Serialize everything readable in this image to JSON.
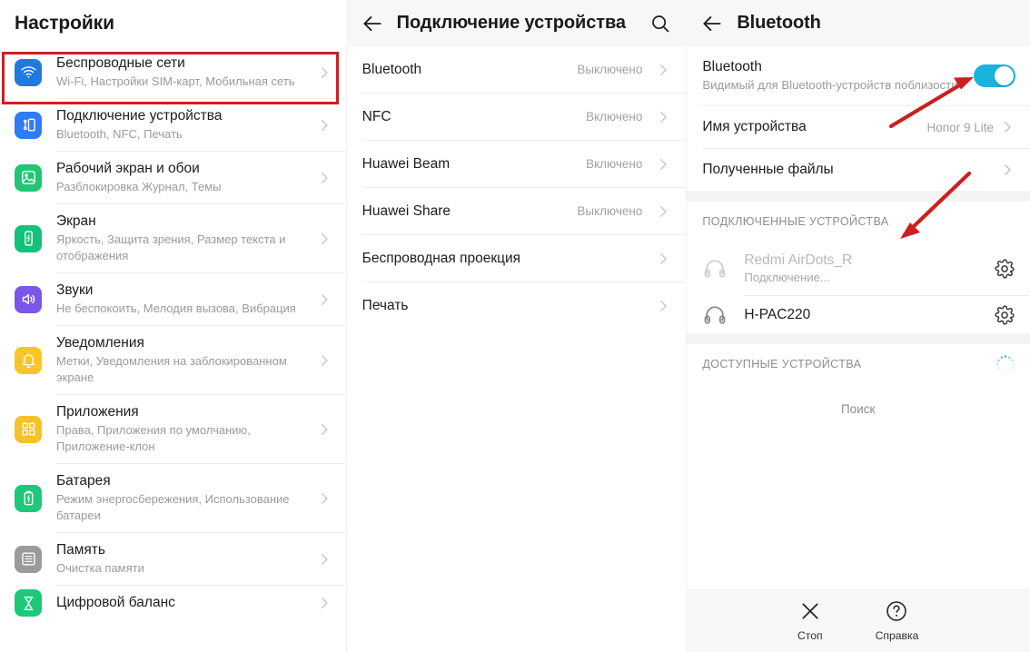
{
  "left_panel": {
    "title": "Настройки",
    "highlight_color": "#cc1f1f",
    "items": [
      {
        "icon": "wifi-icon",
        "icon_color": "#1f7ae0",
        "title": "Беспроводные сети",
        "sub": "Wi-Fi, Настройки SIM-карт, Мобильная сеть",
        "highlighted": true
      },
      {
        "icon": "device-connection-icon",
        "icon_color": "#2f7cf6",
        "title": "Подключение устройства",
        "sub": "Bluetooth, NFC, Печать",
        "highlighted": false
      },
      {
        "icon": "wallpaper-icon",
        "icon_color": "#21c573",
        "title": "Рабочий экран и обои",
        "sub": "Разблокировка Журнал, Темы",
        "highlighted": false
      },
      {
        "icon": "display-icon",
        "icon_color": "#14c07a",
        "title": "Экран",
        "sub": "Яркость, Защита зрения, Размер текста и отображения",
        "highlighted": false
      },
      {
        "icon": "sound-icon",
        "icon_color": "#7b56e8",
        "title": "Звуки",
        "sub": "Не беспокоить, Мелодия вызова, Вибрация",
        "highlighted": false
      },
      {
        "icon": "bell-icon",
        "icon_color": "#fcc526",
        "title": "Уведомления",
        "sub": "Метки, Уведомления на заблокированном экране",
        "highlighted": false
      },
      {
        "icon": "apps-grid-icon",
        "icon_color": "#f5c329",
        "title": "Приложения",
        "sub": "Права, Приложения по умолчанию, Приложение-клон",
        "highlighted": false
      },
      {
        "icon": "battery-icon",
        "icon_color": "#1ec878",
        "title": "Батарея",
        "sub": "Режим энергосбережения, Использование батареи",
        "highlighted": false
      },
      {
        "icon": "storage-icon",
        "icon_color": "#9b9b9b",
        "title": "Память",
        "sub": "Очистка памяти",
        "highlighted": false
      },
      {
        "icon": "hourglass-icon",
        "icon_color": "#1ec878",
        "title": "Цифровой баланс",
        "sub": "",
        "highlighted": false
      }
    ]
  },
  "mid_panel": {
    "header": {
      "title": "Подключение устройства",
      "back_icon": "back-arrow-icon",
      "search_icon": "search-icon"
    },
    "rows": [
      {
        "label": "Bluetooth",
        "value": "Выключено"
      },
      {
        "label": "NFC",
        "value": "Включено"
      },
      {
        "label": "Huawei Beam",
        "value": "Включено"
      },
      {
        "label": "Huawei Share",
        "value": "Выключено"
      },
      {
        "label": "Беспроводная проекция",
        "value": ""
      },
      {
        "label": "Печать",
        "value": ""
      }
    ]
  },
  "right_panel": {
    "header": {
      "title": "Bluetooth",
      "back_icon": "back-arrow-icon"
    },
    "bluetooth": {
      "title": "Bluetooth",
      "sub": "Видимый для Bluetooth-устройств поблизости",
      "toggle_on": true,
      "toggle_color": "#17b4dd"
    },
    "device_name": {
      "label": "Имя устройства",
      "value": "Honor 9 Lite"
    },
    "received_files": {
      "label": "Полученные файлы"
    },
    "connected_section": {
      "title": "ПОДКЛЮЧЕННЫЕ УСТРОЙСТВА",
      "devices": [
        {
          "icon": "headphones-icon",
          "name": "Redmi AirDots_R",
          "state": "Подключение...",
          "dim": true,
          "settings_icon": "gear-icon"
        },
        {
          "icon": "headphones-icon",
          "name": "H-PAC220",
          "state": "",
          "dim": false,
          "settings_icon": "gear-icon"
        }
      ]
    },
    "available_section": {
      "title": "ДОСТУПНЫЕ УСТРОЙСТВА",
      "spinner_icon": "loading-spinner-icon",
      "search_label": "Поиск"
    },
    "bottom_bar": {
      "items": [
        {
          "icon": "close-icon",
          "label": "Стоп"
        },
        {
          "icon": "help-icon",
          "label": "Справка"
        }
      ]
    }
  },
  "annotations": {
    "arrow_color": "#cc1f1f",
    "arrows": [
      {
        "name": "arrow-to-bluetooth-toggle"
      },
      {
        "name": "arrow-to-connected-devices"
      }
    ]
  }
}
